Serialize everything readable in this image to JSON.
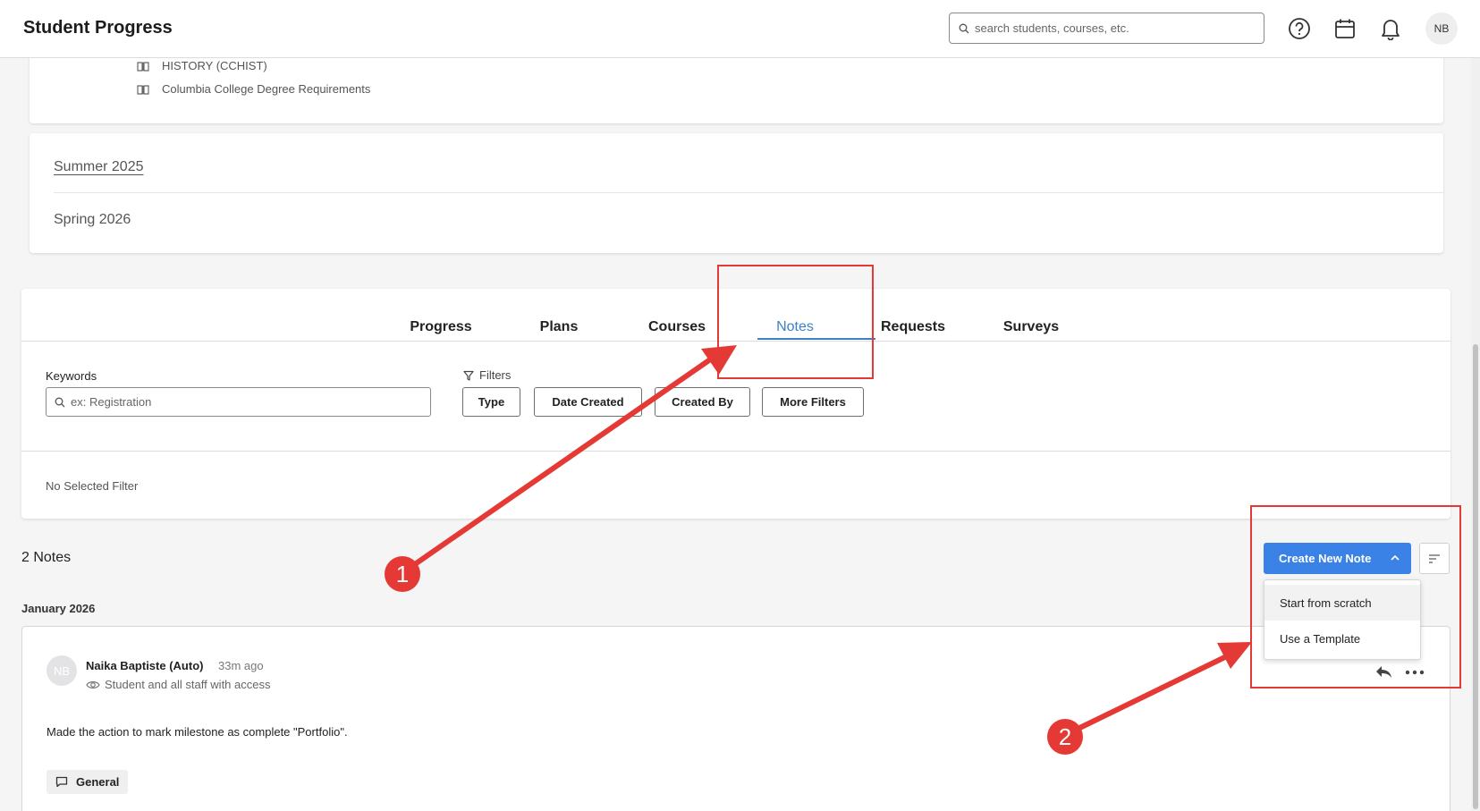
{
  "header": {
    "title": "Student Progress",
    "search_placeholder": "search students, courses, etc.",
    "avatar_initials": "NB"
  },
  "requirements": [
    "HISTORY (CCHIST)",
    "Columbia College Degree Requirements"
  ],
  "terms": [
    "Summer 2025",
    "Spring 2026"
  ],
  "tabs": [
    "Progress",
    "Plans",
    "Courses",
    "Notes",
    "Requests",
    "Surveys"
  ],
  "active_tab": "Notes",
  "filters": {
    "keywords_label": "Keywords",
    "keywords_placeholder": "ex: Registration",
    "filters_label": "Filters",
    "buttons": [
      "Type",
      "Date Created",
      "Created By",
      "More Filters"
    ],
    "selected_filter_text": "No Selected Filter"
  },
  "notes": {
    "count_label": "2 Notes",
    "create_button": "Create New Note",
    "dropdown": [
      "Start from scratch",
      "Use a Template"
    ],
    "month": "January 2026",
    "items": [
      {
        "avatar": "NB",
        "author": "Naika Baptiste (Auto)",
        "time": "33m ago",
        "visibility": "Student and all staff with access",
        "body": "Made the action to mark milestone as complete \"Portfolio\".",
        "tag": "General"
      }
    ]
  },
  "annotations": {
    "badge_1": "1",
    "badge_2": "2"
  },
  "colors": {
    "accent": "#3b82e6",
    "active_tab": "#3b82c4",
    "annotation": "#e53935"
  }
}
